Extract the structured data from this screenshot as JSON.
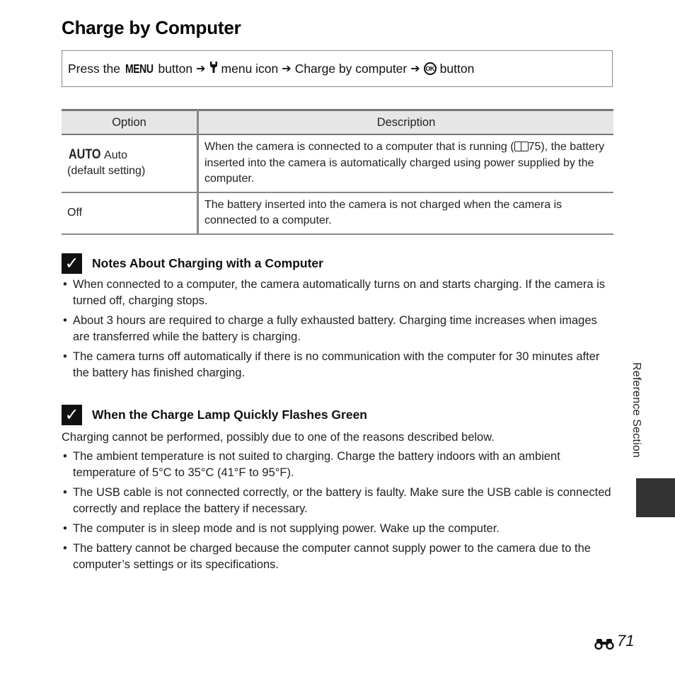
{
  "page": {
    "title": "Charge by Computer",
    "side_label": "Reference Section",
    "page_number": "71",
    "page_prefix_icon": "binoculars-icon"
  },
  "menu_path": {
    "press": "Press the",
    "menu_word": "MENU",
    "button1": "button",
    "arrow": "➔",
    "wrench_icon": "wrench-icon",
    "menu_icon_label": "menu icon",
    "item": "Charge by computer",
    "ok_icon": "OK",
    "button2": "button"
  },
  "options_table": {
    "headers": [
      "Option",
      "Description"
    ],
    "rows": [
      {
        "icon_text": "AUTO",
        "option": "Auto",
        "option_note": "(default setting)",
        "description_pre": "When the camera is connected to a computer that is running (",
        "page_ref": "75",
        "description_post": "), the battery inserted into the camera is automatically charged using power supplied by the computer."
      },
      {
        "option": "Off",
        "description": "The battery inserted into the camera is not charged when the camera is connected to a computer."
      }
    ]
  },
  "notes": [
    {
      "heading": "Notes About Charging with a Computer",
      "intro": "",
      "bullets": [
        "When connected to a computer, the camera automatically turns on and starts charging. If the camera is turned off, charging stops.",
        "About 3 hours are required to charge a fully exhausted battery. Charging time increases when images are transferred while the battery is charging.",
        "The camera turns off automatically if there is no communication with the computer for 30 minutes after the battery has finished charging."
      ]
    },
    {
      "heading": "When the Charge Lamp Quickly Flashes Green",
      "intro": "Charging cannot be performed, possibly due to one of the reasons described below.",
      "bullets": [
        "The ambient temperature is not suited to charging. Charge the battery indoors with an ambient temperature of 5°C to 35°C (41°F to 95°F).",
        "The USB cable is not connected correctly, or the battery is faulty. Make sure the USB cable is connected correctly and replace the battery if necessary.",
        "The computer is in sleep mode and is not supplying power. Wake up the computer.",
        "The battery cannot be charged because the computer cannot supply power to the camera due to the computer’s settings or its specifications."
      ]
    }
  ],
  "colors": {
    "side_tab": "#333333",
    "table_header_bg": "#e6e6e6"
  }
}
